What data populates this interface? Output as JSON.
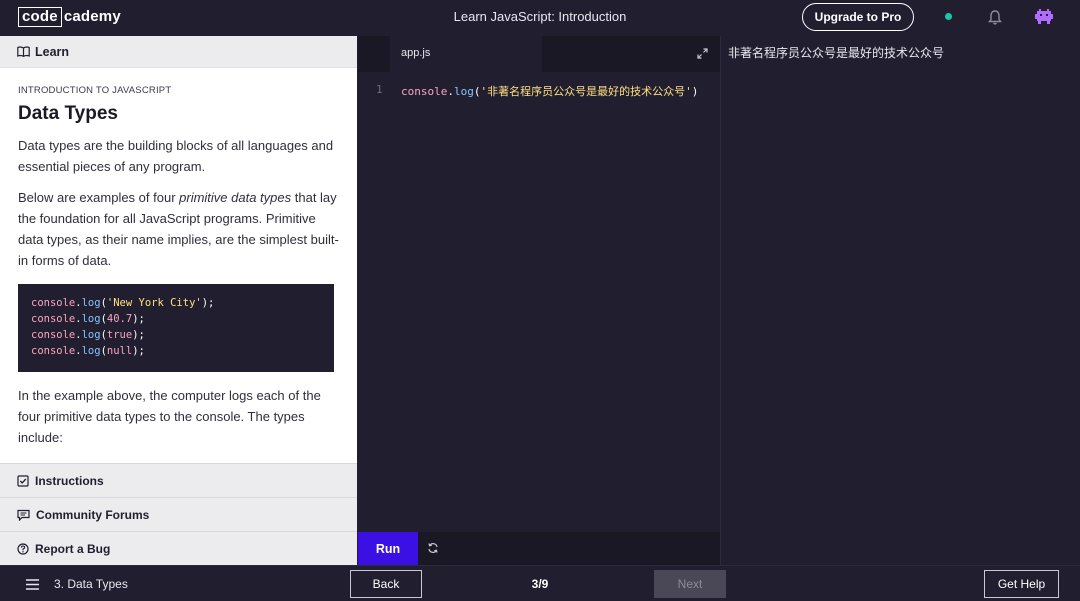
{
  "header": {
    "logo_boxed": "code",
    "logo_rest": "cademy",
    "course_title": "Learn JavaScript: Introduction",
    "upgrade_label": "Upgrade to Pro",
    "status_color": "#19c8a8",
    "icons": [
      "bell-icon",
      "avatar"
    ]
  },
  "learn_panel": {
    "header_label": "Learn",
    "eyebrow": "INTRODUCTION TO JAVASCRIPT",
    "title": "Data Types",
    "para1": "Data types are the building blocks of all languages and essential pieces of any program.",
    "para2_before": "Below are examples of four ",
    "para2_em": "primitive data types",
    "para2_after": " that lay the foundation for all JavaScript programs. Primitive data types, as their name implies, are the simplest built-in forms of data.",
    "code_example": [
      {
        "obj": "console",
        "fn": "log",
        "arg": "'New York City'",
        "arg_type": "str"
      },
      {
        "obj": "console",
        "fn": "log",
        "arg": "40.7",
        "arg_type": "num"
      },
      {
        "obj": "console",
        "fn": "log",
        "arg": "true",
        "arg_type": "kw"
      },
      {
        "obj": "console",
        "fn": "log",
        "arg": "null",
        "arg_type": "kw"
      }
    ],
    "para3": "In the example above, the computer logs each of the four primitive data types to the console. The types include:"
  },
  "left_nav": [
    {
      "label": "Instructions",
      "icon": "checkbox-icon"
    },
    {
      "label": "Community Forums",
      "icon": "chat-icon"
    },
    {
      "label": "Report a Bug",
      "icon": "question-icon"
    }
  ],
  "editor": {
    "tab_name": "app.js",
    "line_number": "1",
    "code_obj": "console",
    "code_fn": "log",
    "code_arg": "'非著名程序员公众号是最好的技术公众号'",
    "run_label": "Run"
  },
  "output": {
    "text": "非著名程序员公众号是最好的技术公众号"
  },
  "footer": {
    "lesson_label": "3. Data Types",
    "back_label": "Back",
    "progress": "3/9",
    "next_label": "Next",
    "help_label": "Get Help"
  },
  "colors": {
    "background": "#211e2f",
    "run_button": "#3a10e5",
    "code_string": "#ffe083",
    "code_function": "#83c5ff",
    "code_object": "#f7a6c0"
  }
}
